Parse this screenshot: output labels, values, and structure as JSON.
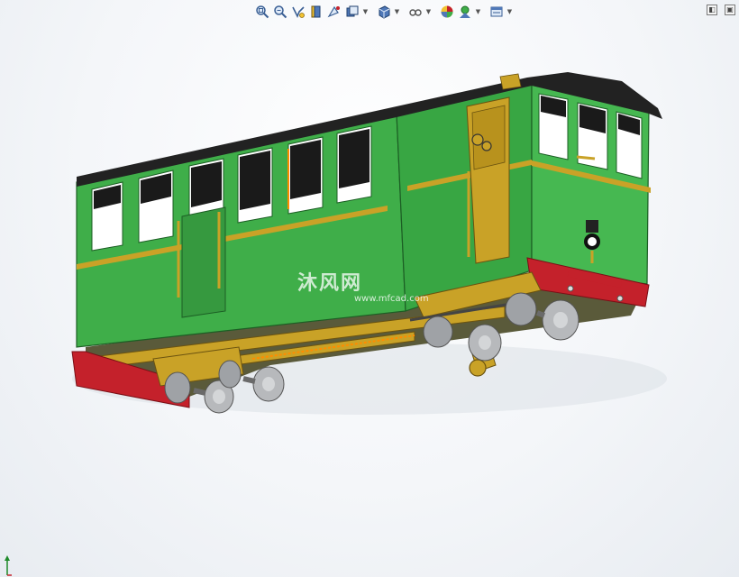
{
  "toolbar": {
    "buttons": [
      {
        "name": "zoom-to-fit",
        "icon": "zoom-fit-icon"
      },
      {
        "name": "zoom-to-area",
        "icon": "zoom-area-icon"
      },
      {
        "name": "previous-view",
        "icon": "previous-view-icon"
      },
      {
        "name": "section-view",
        "icon": "section-view-icon"
      },
      {
        "name": "dynamic-annotation",
        "icon": "annotation-icon"
      },
      {
        "name": "view-orientation",
        "icon": "view-orientation-icon"
      },
      {
        "name": "display-style",
        "icon": "display-style-icon"
      },
      {
        "name": "hide-show-items",
        "icon": "hide-show-icon"
      },
      {
        "name": "edit-appearance",
        "icon": "appearance-icon"
      },
      {
        "name": "apply-scene",
        "icon": "scene-icon"
      },
      {
        "name": "view-settings",
        "icon": "view-settings-icon"
      }
    ]
  },
  "window": {
    "restore_label": "",
    "maximize_label": ""
  },
  "watermark": {
    "text": "沐风网",
    "url": "www.mfcad.com"
  },
  "model": {
    "colors": {
      "body": "#3fae49",
      "trim": "#c9a227",
      "buffer": "#c4212b",
      "roof": "#222222",
      "wheels": "#b7b9bc"
    }
  }
}
